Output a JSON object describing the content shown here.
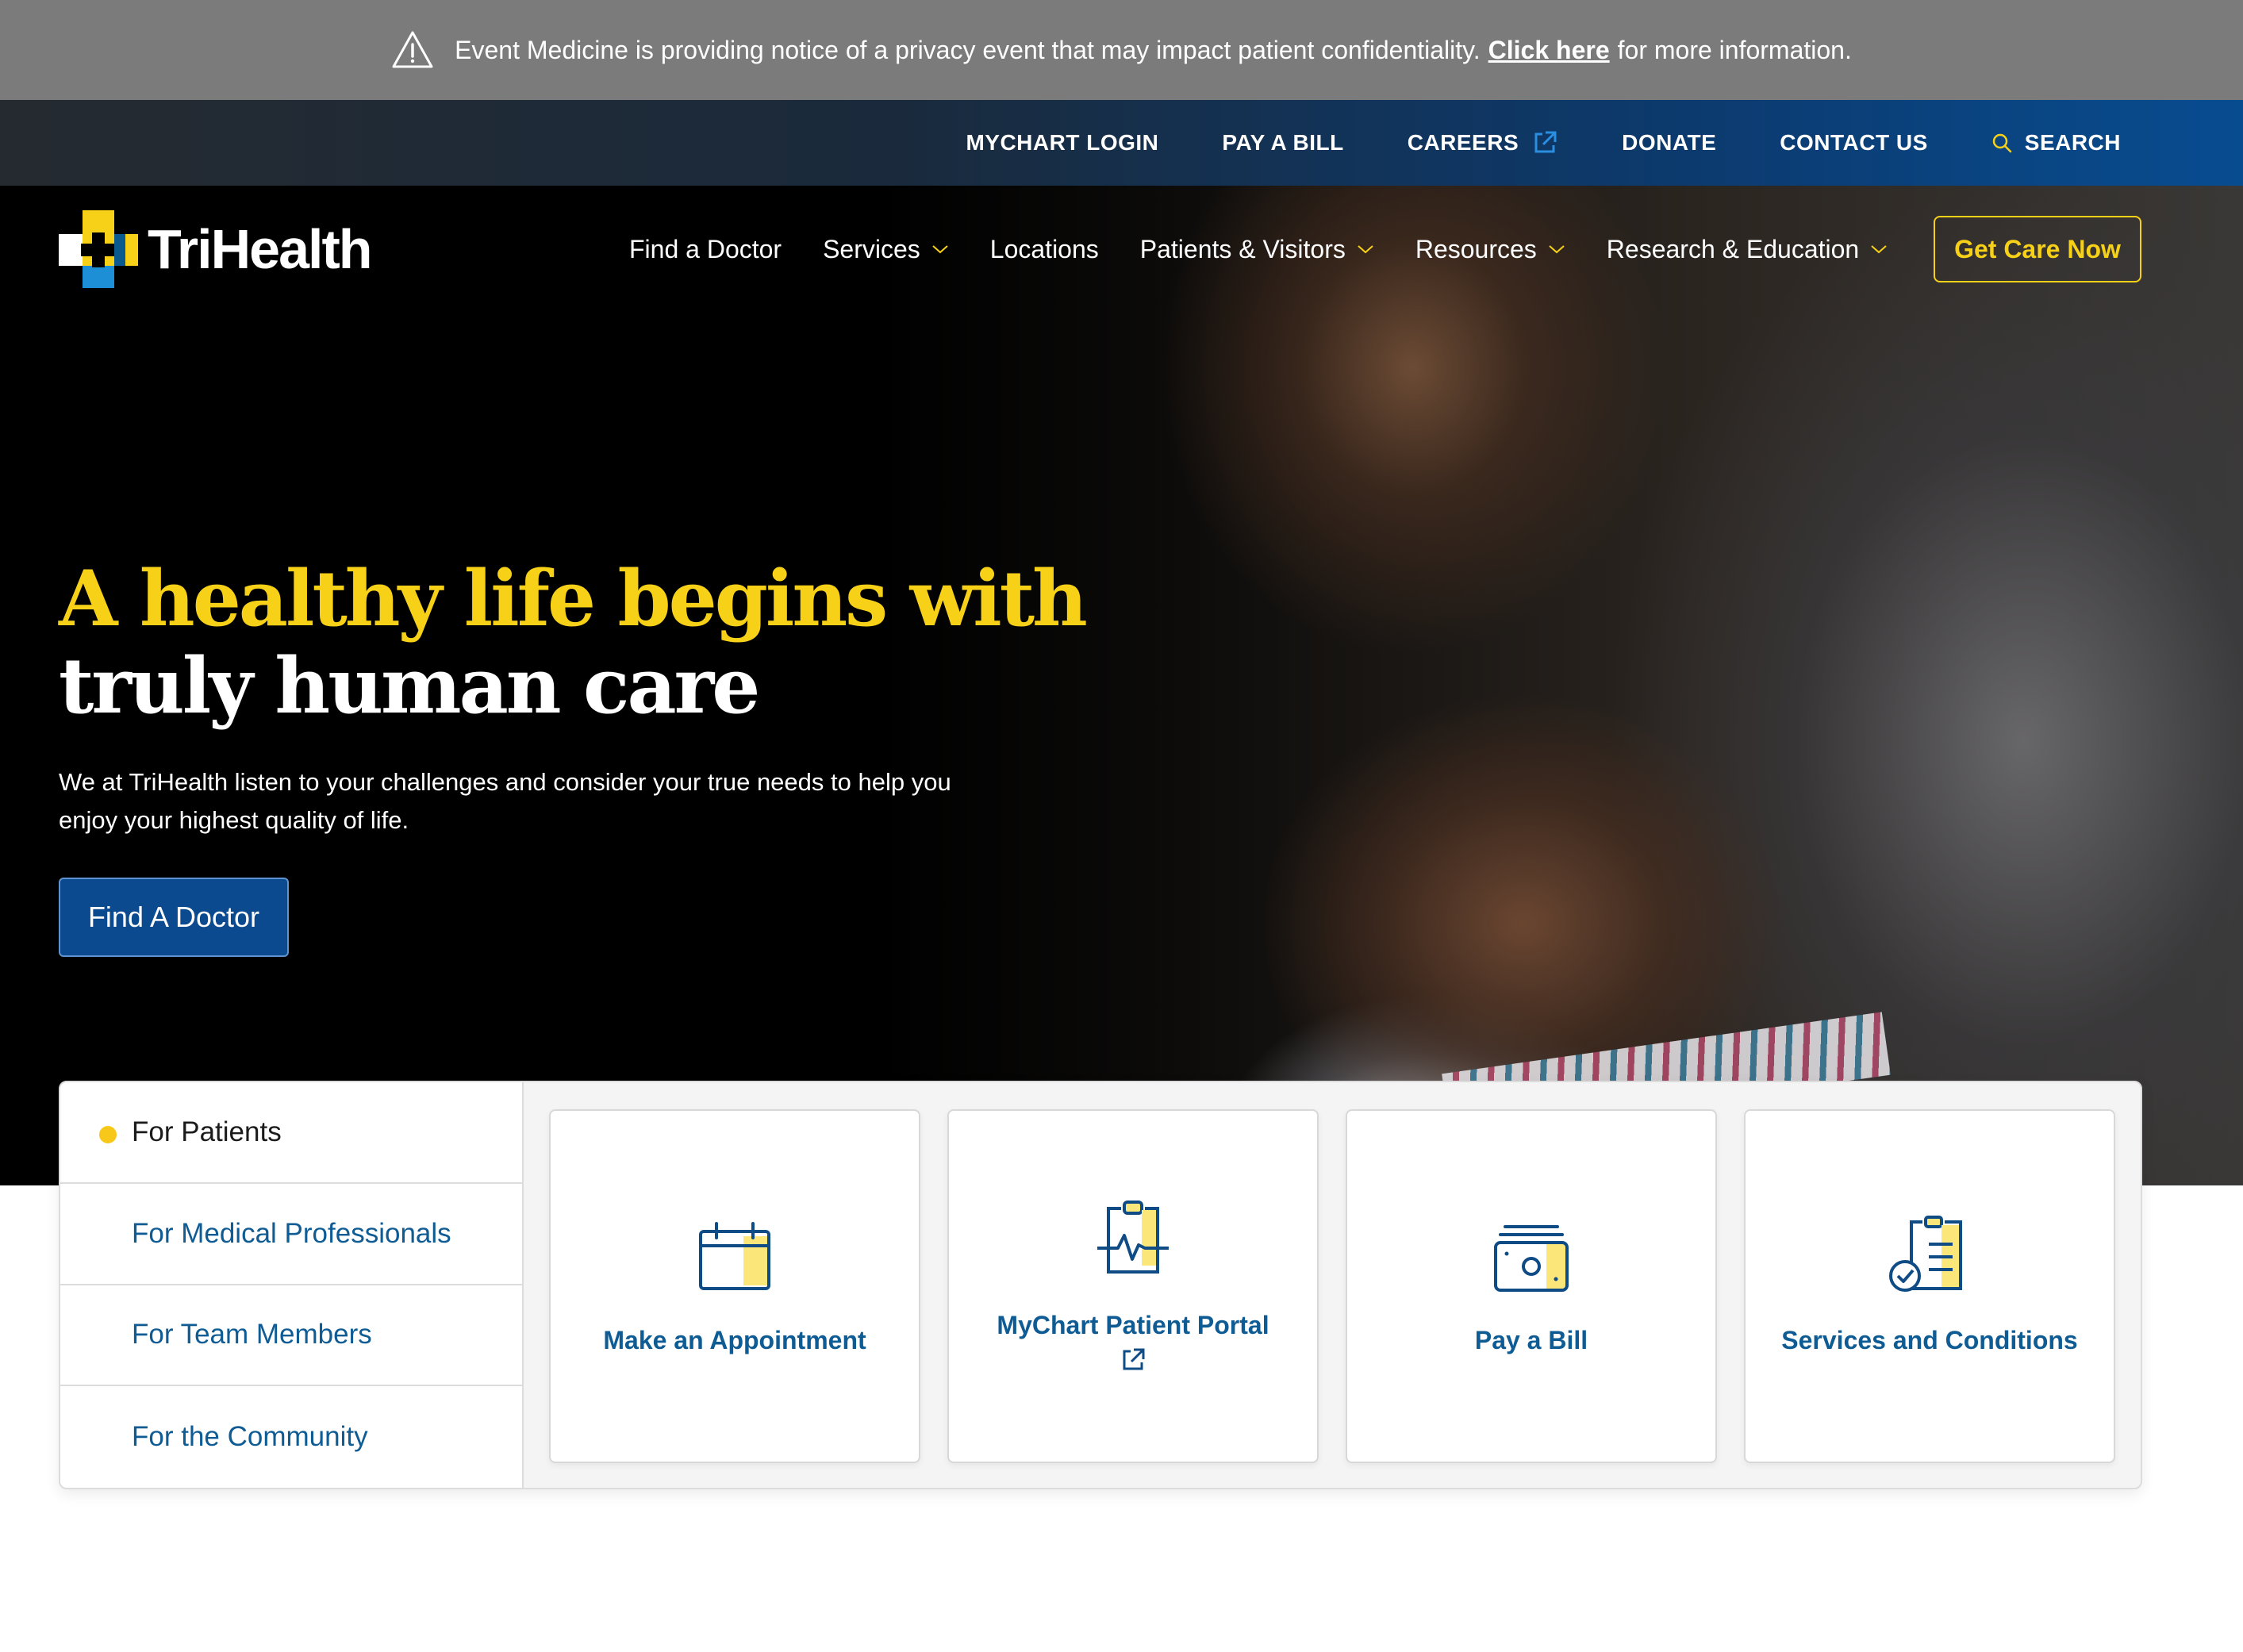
{
  "alert": {
    "text": "Event Medicine is providing notice of a privacy event that may impact patient confidentiality.",
    "link": "Click here",
    "suffix": "for more information.",
    "icon": "warning-triangle-icon"
  },
  "utility_nav": {
    "items": [
      {
        "label": "MYCHART LOGIN"
      },
      {
        "label": "PAY A BILL"
      },
      {
        "label": "CAREERS",
        "icon": "external-link-icon"
      },
      {
        "label": "DONATE"
      },
      {
        "label": "CONTACT US"
      },
      {
        "label": "SEARCH",
        "icon": "search-icon"
      }
    ]
  },
  "brand": {
    "name": "TriHealth",
    "colors": {
      "yellow": "#f7d117",
      "blue": "#0f5c95",
      "dark_blue": "#0b4a8f"
    }
  },
  "main_nav": {
    "items": [
      {
        "label": "Find a Doctor"
      },
      {
        "label": "Services",
        "dropdown": true
      },
      {
        "label": "Locations"
      },
      {
        "label": "Patients & Visitors",
        "dropdown": true
      },
      {
        "label": "Resources",
        "dropdown": true
      },
      {
        "label": "Research & Education",
        "dropdown": true
      }
    ],
    "cta": "Get Care Now"
  },
  "hero": {
    "heading_line1": "A healthy life begins with",
    "heading_line2": "truly human care",
    "subtext": "We at TriHealth listen to your challenges and consider your true needs to help you enjoy your highest quality of life.",
    "button": "Find A Doctor"
  },
  "audience": {
    "tabs": [
      {
        "label": "For Patients",
        "active": true
      },
      {
        "label": "For Medical Professionals"
      },
      {
        "label": "For Team Members"
      },
      {
        "label": "For the Community"
      }
    ],
    "cards": [
      {
        "label": "Make an Appointment",
        "icon": "calendar-icon"
      },
      {
        "label": "MyChart Patient Portal",
        "icon": "clipboard-heartbeat-icon",
        "external": true
      },
      {
        "label": "Pay a Bill",
        "icon": "money-bill-icon"
      },
      {
        "label": "Services and Conditions",
        "icon": "clipboard-check-icon"
      }
    ]
  }
}
